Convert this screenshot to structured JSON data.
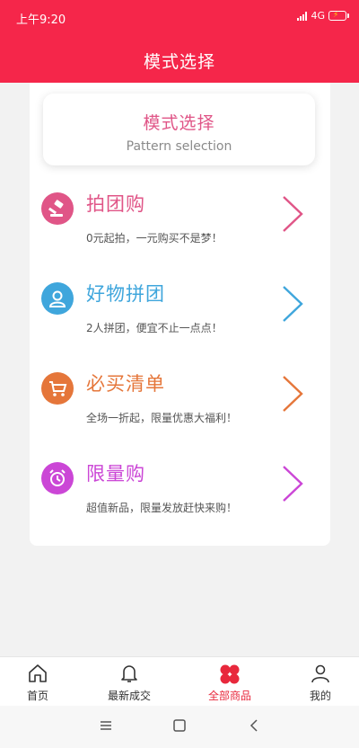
{
  "status": {
    "time": "上午9:20",
    "network": "4G"
  },
  "header": {
    "title": "模式选择"
  },
  "mode_box": {
    "title": "模式选择",
    "subtitle": "Pattern selection"
  },
  "items": [
    {
      "name": "拍团购",
      "desc": "0元起拍，一元购买不是梦！",
      "color": "#e05587",
      "icon": "gavel-icon"
    },
    {
      "name": "好物拼团",
      "desc": "2人拼团，便宜不止一点点！",
      "color": "#3fa6dc",
      "icon": "user-icon"
    },
    {
      "name": "必买清单",
      "desc": "全场一折起，限量优惠大福利！",
      "color": "#e5763a",
      "icon": "cart-icon"
    },
    {
      "name": "限量购",
      "desc": "超值新品，限量发放赶快来购！",
      "color": "#cb46d6",
      "icon": "alarm-clock-icon"
    }
  ],
  "tabs": [
    {
      "label": "首页",
      "icon": "home-icon"
    },
    {
      "label": "最新成交",
      "icon": "bell-icon"
    },
    {
      "label": "全部商品",
      "icon": "grid-icon",
      "active": true
    },
    {
      "label": "我的",
      "icon": "person-icon"
    }
  ],
  "colors": {
    "brand": "#f5264a",
    "active_tab": "#e8283c"
  }
}
